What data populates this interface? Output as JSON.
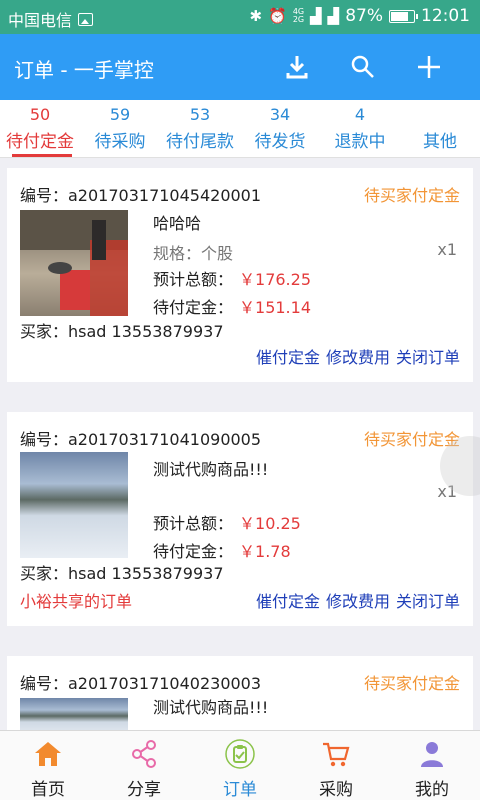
{
  "status_bar": {
    "carrier": "中国电信",
    "battery": "87%",
    "battery_level": 0.87,
    "time": "12:01",
    "net_top": "4G",
    "net_bottom": "2G"
  },
  "app_bar": {
    "title": "订单 - 一手掌控",
    "icons": [
      "download-icon",
      "search-icon",
      "plus-icon"
    ]
  },
  "tabs": [
    {
      "count": "50",
      "label": "待付定金",
      "active": true
    },
    {
      "count": "59",
      "label": "待采购"
    },
    {
      "count": "53",
      "label": "待付尾款"
    },
    {
      "count": "34",
      "label": "待发货"
    },
    {
      "count": "4",
      "label": "退款中"
    },
    {
      "count": "",
      "label": "其他"
    }
  ],
  "orders": [
    {
      "number": "编号：a20170317104542000 1",
      "number_text": "编号：a201703171045420001",
      "status": "待买家付定金",
      "product_name": "哈哈哈",
      "spec": "规格：个股",
      "qty": "x1",
      "total_label": "预计总额：",
      "total": "￥176.25",
      "deposit_label": "待付定金：",
      "deposit": "￥151.14",
      "buyer": "买家：hsad 13553879937",
      "shared": "",
      "actions": [
        "催付定金",
        "修改费用",
        "关闭订单"
      ]
    },
    {
      "number_text": "编号：a201703171041090005",
      "status": "待买家付定金",
      "product_name": "测试代购商品!!!",
      "spec": "",
      "qty": "x1",
      "total_label": "预计总额：",
      "total": "￥10.25",
      "deposit_label": "待付定金：",
      "deposit": "￥1.78",
      "buyer": "买家：hsad 13553879937",
      "shared": "小裕共享的订单",
      "actions": [
        "催付定金",
        "修改费用",
        "关闭订单"
      ]
    },
    {
      "number_text": "编号：a201703171040230003",
      "status": "待买家付定金",
      "product_name": "测试代购商品!!!"
    }
  ],
  "bottom_nav": [
    {
      "label": "首页",
      "icon": "home-icon",
      "color": "#f28a2e"
    },
    {
      "label": "分享",
      "icon": "share-icon",
      "color": "#e86aa8"
    },
    {
      "label": "订单",
      "icon": "order-icon",
      "color": "#8bc34a",
      "active": true
    },
    {
      "label": "采购",
      "icon": "cart-icon",
      "color": "#f0662e"
    },
    {
      "label": "我的",
      "icon": "user-icon",
      "color": "#8a7ad8"
    }
  ],
  "colors": {
    "status_bar": "#37a78a",
    "app_bar": "#2f9cf5",
    "tab_text": "#2a8ad6",
    "active_tab": "#e33b3b",
    "order_status": "#f29536",
    "price": "#e33b3b",
    "action": "#1f3fb8"
  }
}
